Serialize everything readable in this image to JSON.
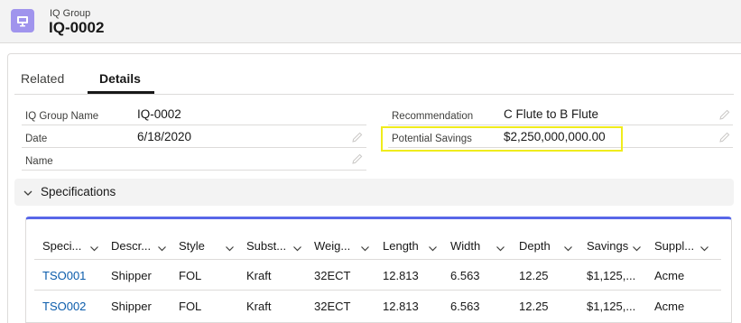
{
  "header": {
    "object_type": "IQ Group",
    "record_title": "IQ-0002",
    "icon": "monitor-icon",
    "icon_color": "#a094ed"
  },
  "tabs": [
    {
      "label": "Related",
      "active": false
    },
    {
      "label": "Details",
      "active": true
    }
  ],
  "fields": {
    "iq_group_name": {
      "label": "IQ Group Name",
      "value": "IQ-0002"
    },
    "date": {
      "label": "Date",
      "value": "6/18/2020"
    },
    "name": {
      "label": "Name",
      "value": ""
    },
    "recommendation": {
      "label": "Recommendation",
      "value": "C Flute to B Flute"
    },
    "potential_savings": {
      "label": "Potential Savings",
      "value": "$2,250,000,000.00"
    }
  },
  "section": {
    "label": "Specifications",
    "expanded": true
  },
  "table": {
    "accent_color": "#5867e8",
    "columns": [
      "Speci...",
      "Descr...",
      "Style",
      "Subst...",
      "Weig...",
      "Length",
      "Width",
      "Depth",
      "Savings",
      "Suppl..."
    ],
    "rows": [
      [
        "TSO001",
        "Shipper",
        "FOL",
        "Kraft",
        "32ECT",
        "12.813",
        "6.563",
        "12.25",
        "$1,125,...",
        "Acme"
      ],
      [
        "TSO002",
        "Shipper",
        "FOL",
        "Kraft",
        "32ECT",
        "12.813",
        "6.563",
        "12.25",
        "$1,125,...",
        "Acme"
      ]
    ]
  },
  "highlight_color": "#f0ec1c"
}
